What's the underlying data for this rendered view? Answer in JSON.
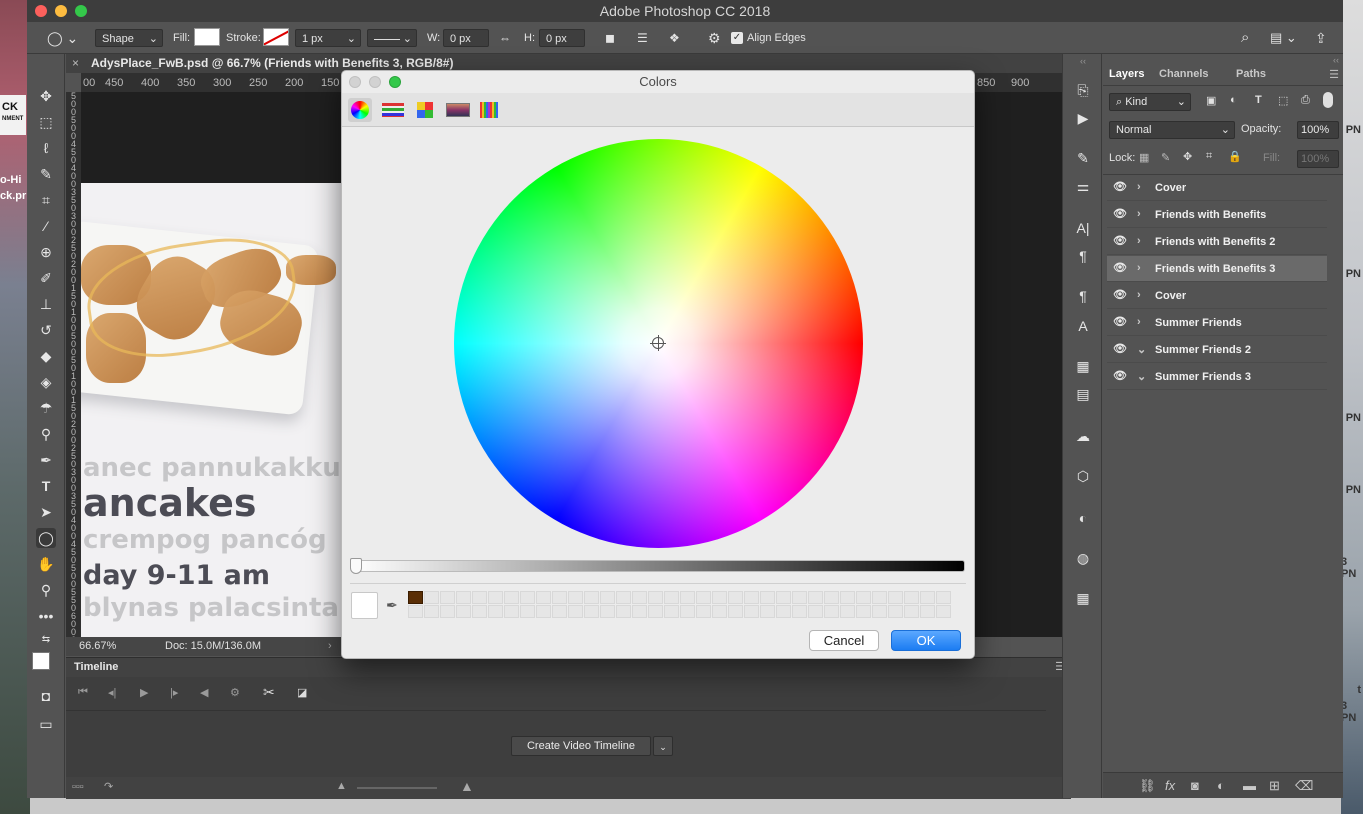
{
  "app_title": "Adobe Photoshop CC 2018",
  "options": {
    "shape_mode": "Shape",
    "fill_label": "Fill:",
    "stroke_label": "Stroke:",
    "stroke_width": "1 px",
    "w_label": "W:",
    "w_value": "0 px",
    "h_label": "H:",
    "h_value": "0 px",
    "align_edges": "Align Edges"
  },
  "document": {
    "tab_title": "AdysPlace_FwB.psd @ 66.7% (Friends with Benefits 3, RGB/8#)",
    "zoom": "66.67%",
    "doc_size": "Doc: 15.0M/136.0M",
    "ruler_labels_left": [
      "00",
      "450",
      "400",
      "350",
      "300",
      "250",
      "200",
      "150"
    ],
    "ruler_labels_right": [
      "850",
      "900"
    ],
    "ruler_v": [
      "5",
      "0",
      "0",
      "5",
      "0",
      "0",
      "4",
      "5",
      "0",
      "4",
      "0",
      "0",
      "3",
      "5",
      "0",
      "3",
      "0",
      "0",
      "2",
      "5",
      "0",
      "2",
      "0",
      "0",
      "1",
      "5",
      "0",
      "1",
      "0",
      "0",
      "5",
      "0",
      "0",
      "5",
      "0",
      "1",
      "0",
      "0",
      "1",
      "5",
      "0",
      "2",
      "0",
      "0",
      "2",
      "5",
      "0",
      "3",
      "0",
      "0",
      "3",
      "5",
      "0",
      "4",
      "0",
      "0",
      "4",
      "5",
      "0",
      "5",
      "0",
      "0",
      "5",
      "5",
      "0",
      "6",
      "0",
      "0",
      "6",
      "5",
      "0"
    ]
  },
  "artboard_text": {
    "line1": "anec pannukakku",
    "line2": "ancakes",
    "line3": "crempog pancóg",
    "line4": "day 9-11 am",
    "line5": "blynas palacsinta"
  },
  "desktop": {
    "left_label1": "CK",
    "left_label2": "NMENT",
    "left_text1": "o-Hi",
    "left_text2": "ck.pr",
    "right_labels": [
      "PN",
      "PN",
      "PN",
      "PN",
      "3 PN",
      "t",
      "3 PN"
    ]
  },
  "timeline": {
    "title": "Timeline",
    "create_button": "Create Video Timeline"
  },
  "layers_panel": {
    "tabs": [
      "Layers",
      "Channels",
      "Paths"
    ],
    "kind": "Kind",
    "blend_mode": "Normal",
    "opacity_label": "Opacity:",
    "opacity_value": "100%",
    "lock_label": "Lock:",
    "fill_label": "Fill:",
    "fill_value": "100%",
    "layers": [
      {
        "name": "Cover",
        "expanded": false,
        "selected": false
      },
      {
        "name": "Friends with Benefits",
        "expanded": false,
        "selected": false
      },
      {
        "name": "Friends with Benefits 2",
        "expanded": false,
        "selected": false
      },
      {
        "name": "Friends with Benefits 3",
        "expanded": false,
        "selected": true
      },
      {
        "name": "Cover",
        "expanded": false,
        "selected": false
      },
      {
        "name": "Summer Friends",
        "expanded": false,
        "selected": false
      },
      {
        "name": "Summer Friends 2",
        "expanded": true,
        "selected": false
      },
      {
        "name": "Summer Friends 3",
        "expanded": true,
        "selected": false
      }
    ]
  },
  "colors_dialog": {
    "title": "Colors",
    "cancel": "Cancel",
    "ok": "OK",
    "selected_color": "#ffffff",
    "saved_swatch": "#5a2e05"
  }
}
